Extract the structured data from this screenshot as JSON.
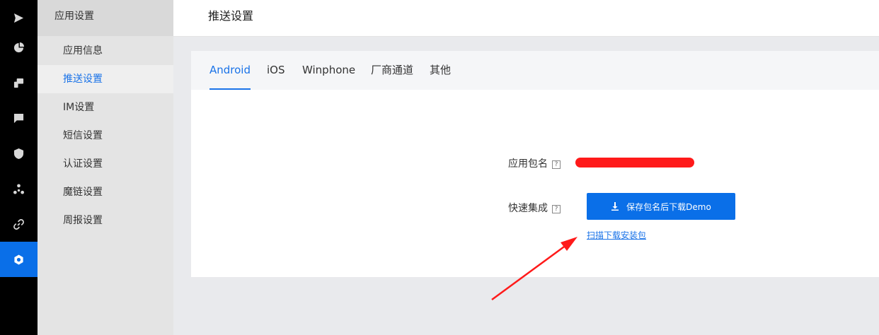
{
  "rail": {
    "icons": [
      "send-icon",
      "pie-chart-icon",
      "devices-icon",
      "message-icon",
      "shield-icon",
      "cluster-icon",
      "link-icon",
      "settings-icon"
    ],
    "active_index": 7
  },
  "submenu": {
    "title": "应用设置",
    "items": [
      {
        "label": "应用信息"
      },
      {
        "label": "推送设置"
      },
      {
        "label": "IM设置"
      },
      {
        "label": "短信设置"
      },
      {
        "label": "认证设置"
      },
      {
        "label": "魔链设置"
      },
      {
        "label": "周报设置"
      }
    ],
    "active_index": 1
  },
  "header": {
    "title": "推送设置"
  },
  "tabs": [
    {
      "label": "Android"
    },
    {
      "label": "iOS"
    },
    {
      "label": "Winphone"
    },
    {
      "label": "厂商通道"
    },
    {
      "label": "其他"
    }
  ],
  "active_tab": 0,
  "form": {
    "package_label": "应用包名",
    "quick_label": "快速集成",
    "help_glyph": "?",
    "download_button": "保存包名后下载Demo",
    "scan_link": "扫描下载安装包"
  },
  "colors": {
    "accent": "#0a6fe8",
    "rail_bg": "#000000",
    "annotation": "#ff1a1a"
  }
}
